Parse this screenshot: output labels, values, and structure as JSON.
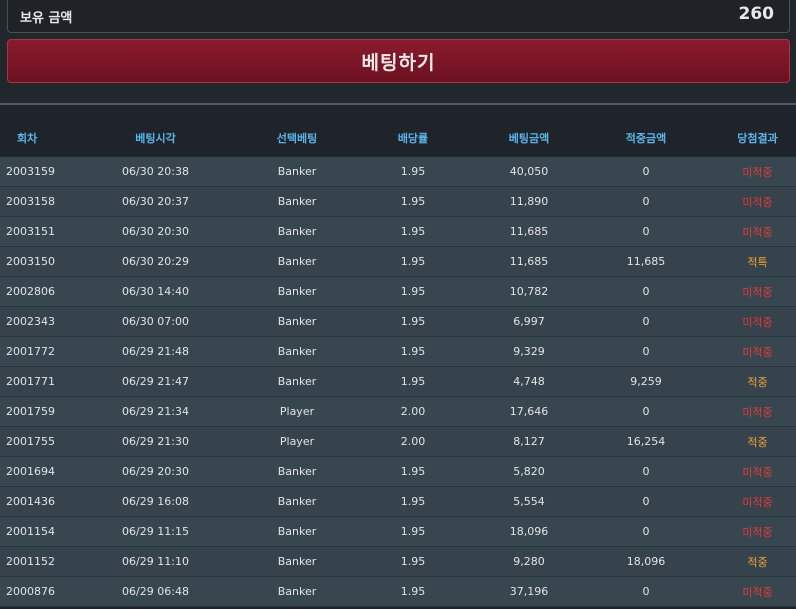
{
  "balance": {
    "label": "보유 금액",
    "value": "260"
  },
  "bet_button": {
    "label": "베팅하기"
  },
  "table": {
    "headers": [
      "회차",
      "베팅시각",
      "선택베팅",
      "배당률",
      "베팅금액",
      "적중금액",
      "당첨결과"
    ],
    "rows": [
      [
        "2003159",
        "06/30 20:38",
        "Banker",
        "1.95",
        "40,050",
        "0",
        "미적중"
      ],
      [
        "2003158",
        "06/30 20:37",
        "Banker",
        "1.95",
        "11,890",
        "0",
        "미적중"
      ],
      [
        "2003151",
        "06/30 20:30",
        "Banker",
        "1.95",
        "11,685",
        "0",
        "미적중"
      ],
      [
        "2003150",
        "06/30 20:29",
        "Banker",
        "1.95",
        "11,685",
        "11,685",
        "적특"
      ],
      [
        "2002806",
        "06/30 14:40",
        "Banker",
        "1.95",
        "10,782",
        "0",
        "미적중"
      ],
      [
        "2002343",
        "06/30 07:00",
        "Banker",
        "1.95",
        "6,997",
        "0",
        "미적중"
      ],
      [
        "2001772",
        "06/29 21:48",
        "Banker",
        "1.95",
        "9,329",
        "0",
        "미적중"
      ],
      [
        "2001771",
        "06/29 21:47",
        "Banker",
        "1.95",
        "4,748",
        "9,259",
        "적중"
      ],
      [
        "2001759",
        "06/29 21:34",
        "Player",
        "2.00",
        "17,646",
        "0",
        "미적중"
      ],
      [
        "2001755",
        "06/29 21:30",
        "Player",
        "2.00",
        "8,127",
        "16,254",
        "적중"
      ],
      [
        "2001694",
        "06/29 20:30",
        "Banker",
        "1.95",
        "5,820",
        "0",
        "미적중"
      ],
      [
        "2001436",
        "06/29 16:08",
        "Banker",
        "1.95",
        "5,554",
        "0",
        "미적중"
      ],
      [
        "2001154",
        "06/29 11:15",
        "Banker",
        "1.95",
        "18,096",
        "0",
        "미적중"
      ],
      [
        "2001152",
        "06/29 11:10",
        "Banker",
        "1.95",
        "9,280",
        "18,096",
        "적중"
      ],
      [
        "2000876",
        "06/29 06:48",
        "Banker",
        "1.95",
        "37,196",
        "0",
        "미적중"
      ]
    ]
  },
  "colors": {
    "header_text": "#5bb4ea",
    "result_lose": "#e23b3b",
    "result_win": "#f2a233",
    "button_bg": "#7a1526"
  }
}
